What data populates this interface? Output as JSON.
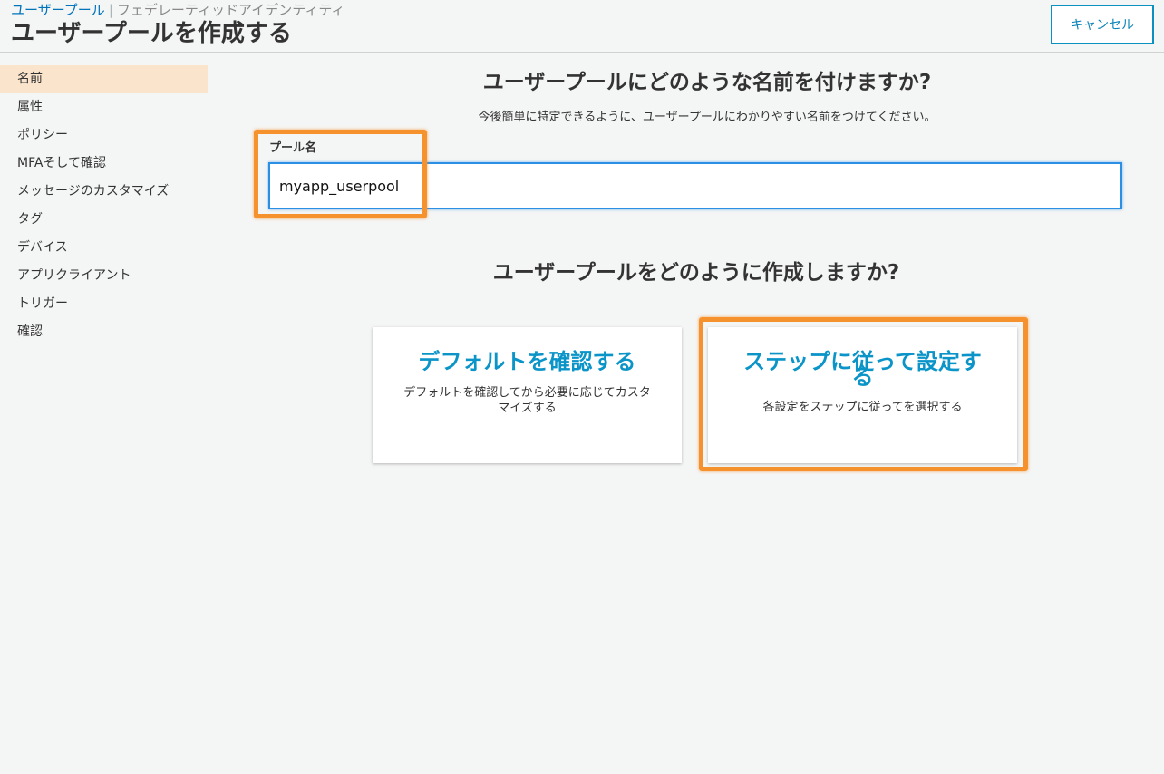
{
  "breadcrumb": {
    "active": "ユーザープール",
    "separator": "|",
    "inactive": "フェデレーティッドアイデンティティ"
  },
  "header": {
    "title": "ユーザープールを作成する",
    "cancel_label": "キャンセル"
  },
  "sidebar": {
    "items": [
      {
        "label": "名前",
        "active": true
      },
      {
        "label": "属性"
      },
      {
        "label": "ポリシー"
      },
      {
        "label": "MFAそして確認"
      },
      {
        "label": "メッセージのカスタマイズ"
      },
      {
        "label": "タグ"
      },
      {
        "label": "デバイス"
      },
      {
        "label": "アプリクライアント"
      },
      {
        "label": "トリガー"
      },
      {
        "label": "確認"
      }
    ]
  },
  "main": {
    "name_question": "ユーザープールにどのような名前を付けますか?",
    "name_hint": "今後簡単に特定できるように、ユーザープールにわかりやすい名前をつけてください。",
    "pool_name_label": "プール名",
    "pool_name_value": "myapp_userpool",
    "create_question": "ユーザープールをどのように作成しますか?",
    "options": [
      {
        "title": "デフォルトを確認する",
        "description": "デフォルトを確認してから必要に応じてカスタマイズする"
      },
      {
        "title": "ステップに従って設定する",
        "description": "各設定をステップに従ってを選択する"
      }
    ]
  },
  "colors": {
    "accent": "#0a94c8",
    "active_nav_bg": "#fae5cc",
    "highlight": "#f6922e",
    "input_focus": "#2a8fe5"
  }
}
